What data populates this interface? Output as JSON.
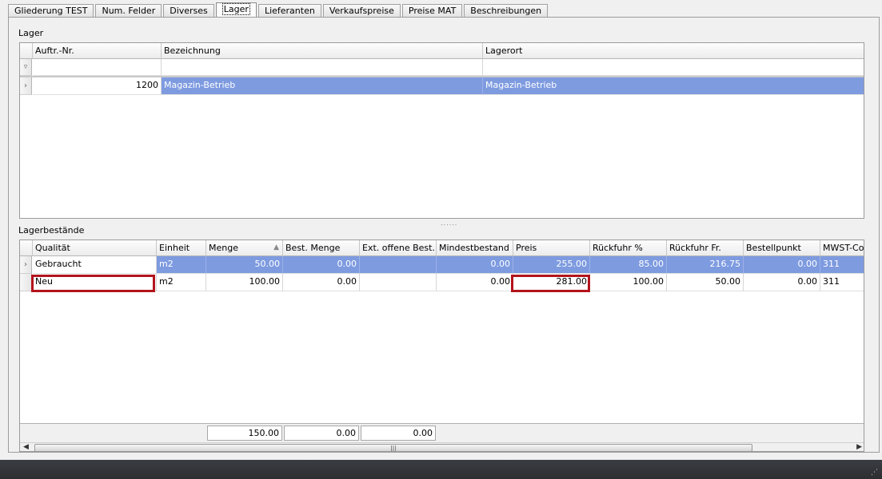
{
  "tabs": [
    {
      "label": "Gliederung TEST",
      "active": false
    },
    {
      "label": "Num. Felder",
      "active": false
    },
    {
      "label": "Diverses",
      "active": false
    },
    {
      "label": "Lager",
      "active": true
    },
    {
      "label": "Lieferanten",
      "active": false
    },
    {
      "label": "Verkaufspreise",
      "active": false
    },
    {
      "label": "Preise MAT",
      "active": false
    },
    {
      "label": "Beschreibungen",
      "active": false
    }
  ],
  "lager": {
    "label": "Lager",
    "columns": [
      "Auftr.-Nr.",
      "Bezeichnung",
      "Lagerort"
    ],
    "filter_icon": "filter-icon",
    "rows": [
      {
        "auftr_nr": "1200",
        "bezeichnung": "Magazin-Betrieb",
        "lagerort": "Magazin-Betrieb"
      }
    ]
  },
  "splitter_glyph": "......",
  "bestaende": {
    "label": "Lagerbestände",
    "columns": [
      "Qualität",
      "Einheit",
      "Menge",
      "Best. Menge",
      "Ext. offene Best...",
      "Mindestbestand",
      "Preis",
      "Rückfuhr %",
      "Rückfuhr Fr.",
      "Bestellpunkt",
      "MWST-Code"
    ],
    "sort_column": "Menge",
    "rows": [
      {
        "qualitaet": "Gebraucht",
        "einheit": "m2",
        "menge": "50.00",
        "best_menge": "0.00",
        "ext_offene": "",
        "mindestbestand": "0.00",
        "preis": "255.00",
        "rueckfuhr_pct": "85.00",
        "rueckfuhr_fr": "216.75",
        "bestellpunkt": "0.00",
        "mwst": "311"
      },
      {
        "qualitaet": "Neu",
        "einheit": "m2",
        "menge": "100.00",
        "best_menge": "0.00",
        "ext_offene": "",
        "mindestbestand": "0.00",
        "preis": "281.00",
        "rueckfuhr_pct": "100.00",
        "rueckfuhr_fr": "50.00",
        "bestellpunkt": "0.00",
        "mwst": "311"
      }
    ],
    "totals": {
      "menge": "150.00",
      "best_menge": "0.00",
      "ext_offene": "0.00"
    },
    "scroll_thumb_glyph": "|||"
  },
  "colors": {
    "selection": "#7e9be0",
    "highlight": "#b3141c"
  }
}
